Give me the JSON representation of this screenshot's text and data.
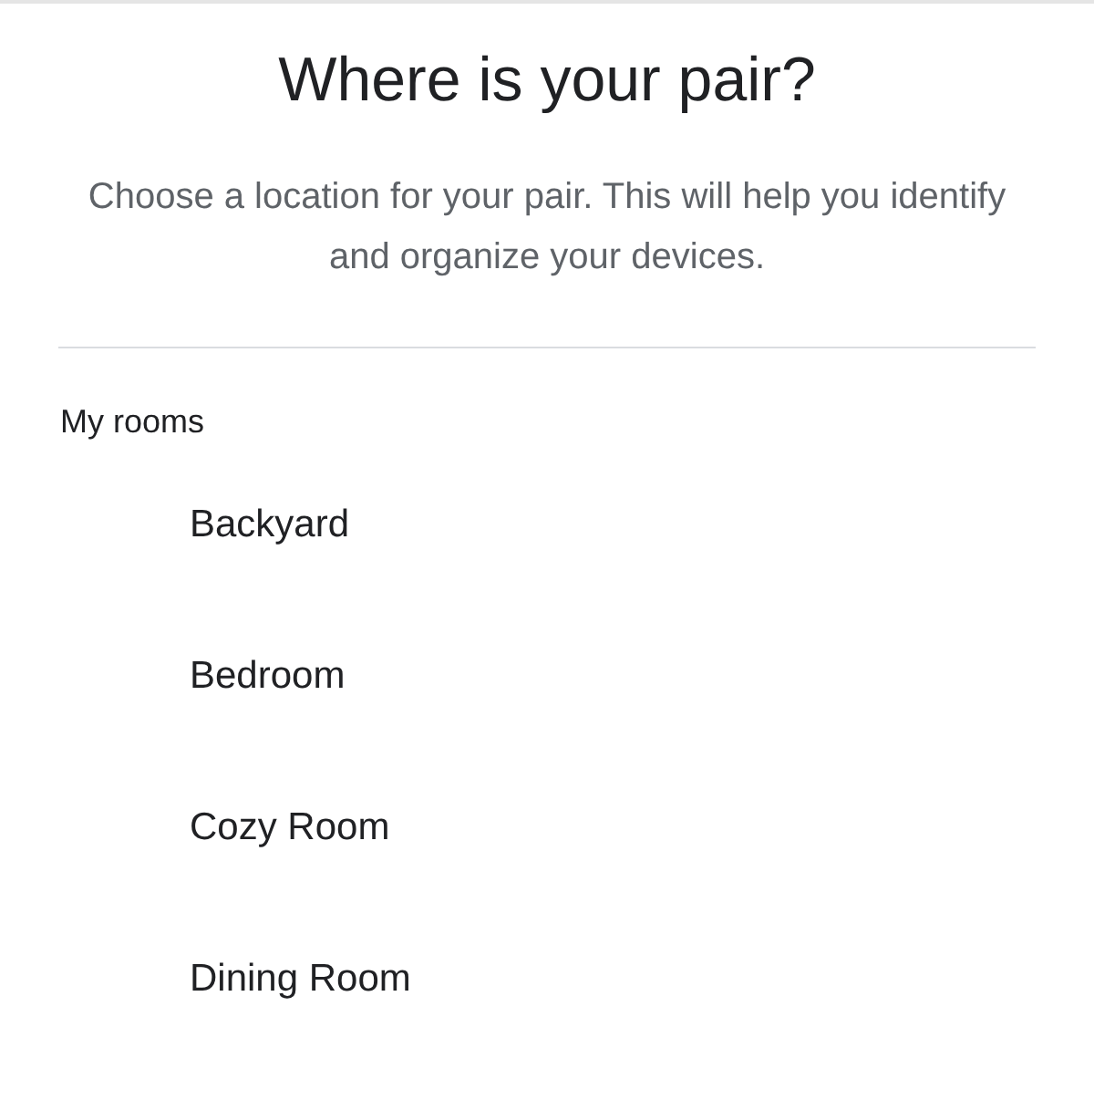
{
  "title": "Where is your pair?",
  "subtitle": "Choose a location for your pair. This will help you identify and organize your devices.",
  "section": "My rooms",
  "rooms": [
    {
      "label": "Backyard"
    },
    {
      "label": "Bedroom"
    },
    {
      "label": "Cozy Room"
    },
    {
      "label": "Dining Room"
    }
  ]
}
